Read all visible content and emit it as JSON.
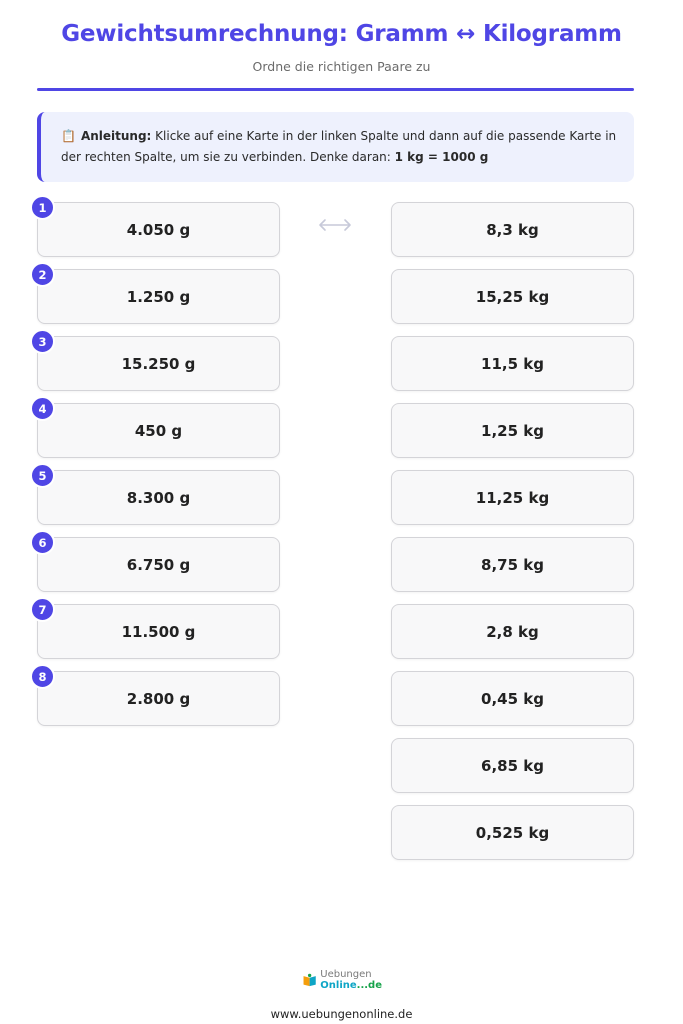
{
  "header": {
    "title": "Gewichtsumrechnung: Gramm ↔ Kilogramm",
    "subtitle": "Ordne die richtigen Paare zu"
  },
  "instructions": {
    "icon": "clipboard-icon",
    "label": "Anleitung:",
    "text": " Klicke auf eine Karte in der linken Spalte und dann auf die passende Karte in der rechten Spalte, um sie zu verbinden. Denke daran: ",
    "rule": "1 kg = 1000 g"
  },
  "left_cards": [
    {
      "number": "1",
      "value": "4.050 g"
    },
    {
      "number": "2",
      "value": "1.250 g"
    },
    {
      "number": "3",
      "value": "15.250 g"
    },
    {
      "number": "4",
      "value": "450 g"
    },
    {
      "number": "5",
      "value": "8.300 g"
    },
    {
      "number": "6",
      "value": "6.750 g"
    },
    {
      "number": "7",
      "value": "11.500 g"
    },
    {
      "number": "8",
      "value": "2.800 g"
    }
  ],
  "right_cards": [
    "8,3 kg",
    "15,25 kg",
    "11,5 kg",
    "1,25 kg",
    "11,25 kg",
    "8,75 kg",
    "2,8 kg",
    "0,45 kg",
    "6,85 kg",
    "0,525 kg"
  ],
  "footer": {
    "logo_top": "Uebungen",
    "logo_bottom": "Online",
    "logo_suffix": "...de",
    "url": "www.uebungenonline.de"
  },
  "colors": {
    "accent": "#4f46e5",
    "instruction_bg": "#eef1fd",
    "card_bg": "#f8f8f9",
    "card_border": "#d4d4d8"
  }
}
